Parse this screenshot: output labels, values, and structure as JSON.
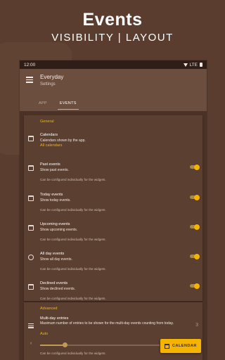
{
  "promo": {
    "title": "Events",
    "subtitle": "VISIBILITY | LAYOUT"
  },
  "status_bar": {
    "time": "12:00",
    "network": "LTE"
  },
  "app_bar": {
    "title": "Everyday",
    "subtitle": "Settings",
    "tabs": [
      {
        "label": "APP",
        "active": false
      },
      {
        "label": "EVENTS",
        "active": true
      }
    ]
  },
  "general": {
    "title": "General",
    "calendars": {
      "title": "Calendars",
      "description": "Calendars shown by the app.",
      "value": "All calendars",
      "icon": "calendar-icon"
    },
    "items": [
      {
        "title": "Past events",
        "description": "Show past events.",
        "note": "Can be configured individually for the widgets.",
        "enabled": true,
        "icon": "calendar-check-icon"
      },
      {
        "title": "Today events",
        "description": "Show today events.",
        "note": "Can be configured individually for the widgets.",
        "enabled": true,
        "icon": "calendar-today-icon"
      },
      {
        "title": "Upcoming events",
        "description": "Show upcoming events.",
        "note": "Can be configured individually for the widgets.",
        "enabled": true,
        "icon": "calendar-upcoming-icon"
      },
      {
        "title": "All day events",
        "description": "Show all day events.",
        "note": "Can be configured individually for the widgets.",
        "enabled": true,
        "icon": "clock-icon"
      },
      {
        "title": "Declined events",
        "description": "Show declined events.",
        "note": "Can be configured individually for the widgets.",
        "enabled": true,
        "icon": "calendar-declined-icon"
      }
    ]
  },
  "advanced": {
    "title": "Advanced",
    "multi_day": {
      "title": "Multi-day entries",
      "description": "Maximum number of entries to be shown for the multi-day events counting from today.",
      "value": "Auto",
      "slider_value": "3",
      "note": "Can be configured individually for the widgets.",
      "icon": "list-icon"
    }
  },
  "fab": {
    "label": "CALENDAR",
    "icon": "calendar-icon"
  },
  "colors": {
    "accent": "#f5b400",
    "background": "#5a3d2e",
    "app_bar": "#6c4e3e",
    "card": "#5b3f31"
  }
}
